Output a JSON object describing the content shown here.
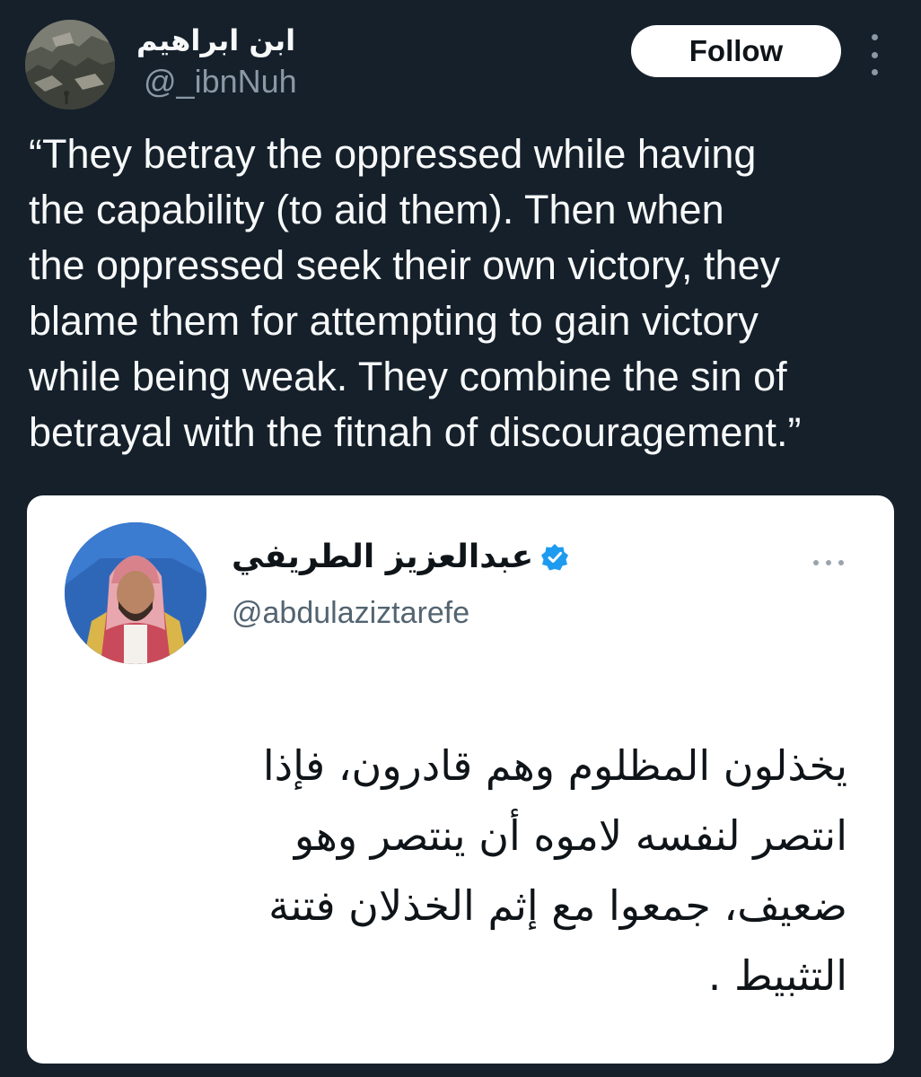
{
  "tweet": {
    "author": {
      "display_name": "ابن ابراهيم",
      "handle": "@_ibnNuh"
    },
    "follow_label": "Follow",
    "more_icon": "more-vertical-icon",
    "text_lines": [
      "“They betray the oppressed while having",
      "the capability (to aid them). Then when",
      "the oppressed seek their own victory, they",
      "blame them for attempting to gain victory",
      "while being weak. They combine the sin of",
      "betrayal with the fitnah of discouragement.”"
    ]
  },
  "quoted_tweet": {
    "author": {
      "display_name": "عبدالعزيز الطريفي",
      "handle": "@abdulaziztarefe",
      "verified_icon": "verified-badge-icon"
    },
    "more_icon": "more-horizontal-icon",
    "text_lines": [
      "يخذلون المظلوم وهم قادرون، فإذا",
      "انتصر لنفسه لاموه أن ينتصر وهو",
      "ضعيف، جمعوا مع إثم الخذلان فتنة",
      "التثبيط ."
    ]
  },
  "colors": {
    "background": "#15202b",
    "text_primary": "#f7f9f9",
    "text_secondary": "#8b98a5",
    "follow_button_bg": "#ffffff",
    "card_bg": "#ffffff",
    "verified_blue": "#1d9bf0"
  }
}
